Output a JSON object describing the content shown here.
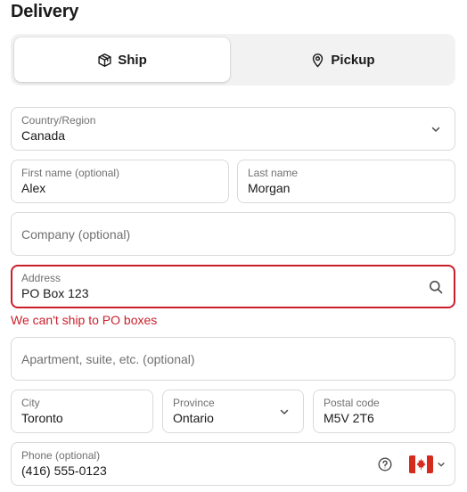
{
  "heading": "Delivery",
  "delivery_method": {
    "options": [
      {
        "label": "Ship",
        "icon": "package-icon",
        "selected": true
      },
      {
        "label": "Pickup",
        "icon": "location-pin-icon",
        "selected": false
      }
    ]
  },
  "form": {
    "country": {
      "label": "Country/Region",
      "value": "Canada"
    },
    "first_name": {
      "label": "First name (optional)",
      "value": "Alex"
    },
    "last_name": {
      "label": "Last name",
      "value": "Morgan"
    },
    "company": {
      "placeholder": "Company (optional)"
    },
    "address": {
      "label": "Address",
      "value": "PO Box 123",
      "error": "We can't ship to PO boxes"
    },
    "apartment": {
      "placeholder": "Apartment, suite, etc. (optional)"
    },
    "city": {
      "label": "City",
      "value": "Toronto"
    },
    "province": {
      "label": "Province",
      "value": "Ontario"
    },
    "postal_code": {
      "label": "Postal code",
      "value": "M5V 2T6"
    },
    "phone": {
      "label": "Phone (optional)",
      "value": "(416) 555-0123",
      "country_flag": "canada-flag-icon"
    }
  },
  "colors": {
    "error": "#c91f2a",
    "border": "#d9d9d9",
    "toggle_bg": "#f2f2f2",
    "flag_red": "#d52b1e"
  }
}
